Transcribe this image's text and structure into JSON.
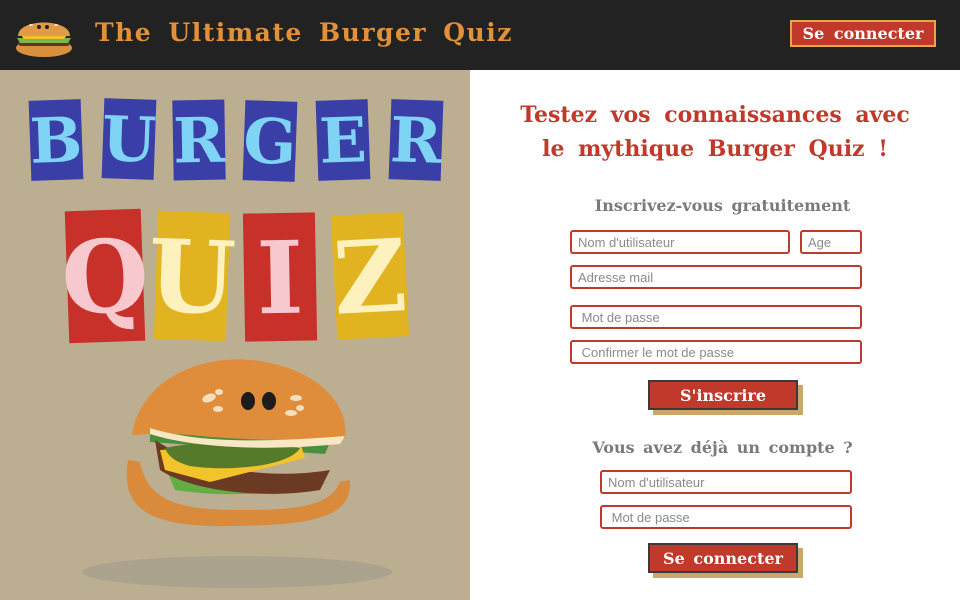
{
  "header": {
    "logo_icon": "burger-icon",
    "title": "The Ultimate Burger Quiz",
    "login_button": "Se connecter",
    "background": "#222222",
    "title_color": "#e0913a"
  },
  "hero": {
    "word1_letters": [
      "B",
      "U",
      "R",
      "G",
      "E",
      "R"
    ],
    "word2_letters": [
      "Q",
      "U",
      "I",
      "Z"
    ],
    "mascot_icon": "burger-mascot-icon"
  },
  "main": {
    "headline_line1": "Testez vos connaissances  avec",
    "headline_line2": "le mythique Burger Quiz !",
    "register": {
      "title": "Inscrivez-vous gratuitement",
      "username_placeholder": "Nom d'utilisateur",
      "age_placeholder": "Age",
      "email_placeholder": "Adresse mail",
      "password_placeholder": " Mot de passe",
      "confirm_placeholder": " Confirmer le mot de passe",
      "submit_label": "S'inscrire"
    },
    "login": {
      "title": "Vous avez déjà un compte ?",
      "username_placeholder": "Nom d'utilisateur",
      "password_placeholder": " Mot de passe",
      "submit_label": "Se connecter"
    }
  },
  "colors": {
    "accent": "#c0392b",
    "left_panel": "#bcae91",
    "button_shadow": "#c9a66b"
  }
}
